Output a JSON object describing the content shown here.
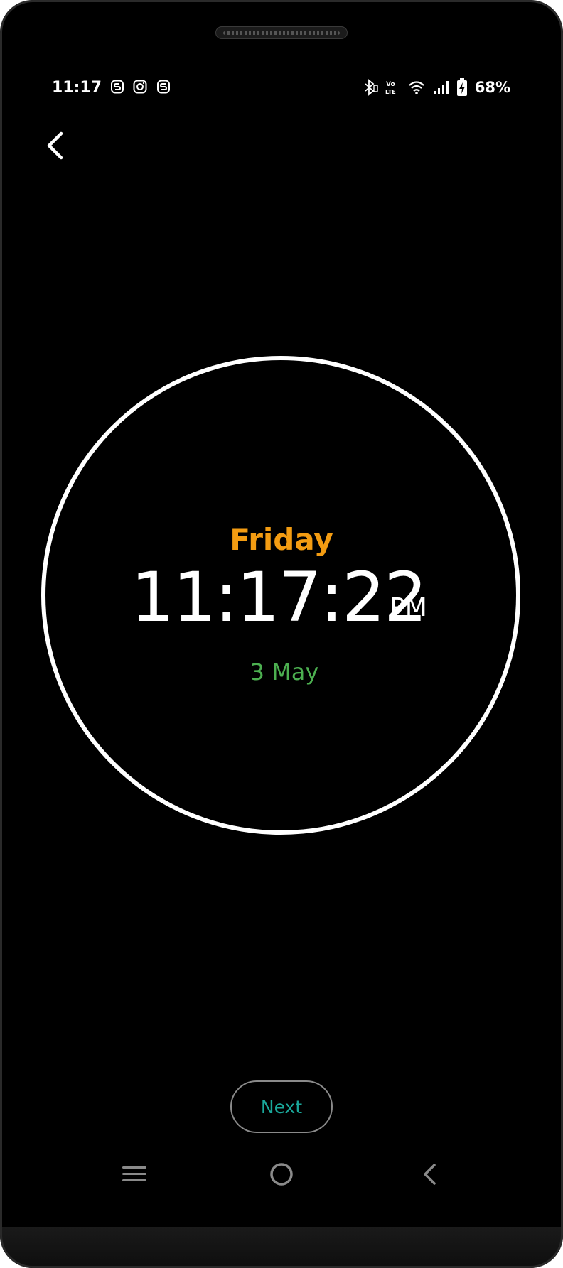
{
  "status_bar": {
    "time": "11:17",
    "battery_percent": "68%",
    "notification_icons": [
      "s-app-icon",
      "instagram-icon",
      "s-app-icon"
    ],
    "system_icons": [
      "bluetooth-icon",
      "volte-icon",
      "wifi-icon",
      "signal-icon",
      "battery-charging-icon"
    ]
  },
  "clock": {
    "day": "Friday",
    "time": "11:17:22",
    "period": "PM",
    "date": "3 May"
  },
  "actions": {
    "next_label": "Next"
  },
  "nav_bar": {
    "items": [
      "recent-apps",
      "home",
      "back"
    ]
  },
  "colors": {
    "background": "#000000",
    "day": "#f39c12",
    "date": "#4caf50",
    "next_text": "#1aa79a",
    "ring": "#ffffff"
  }
}
